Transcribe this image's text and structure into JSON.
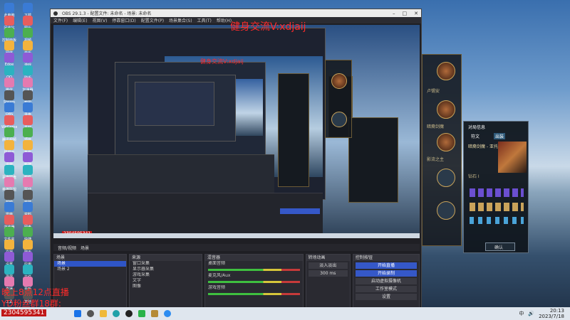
{
  "desktop": {
    "icons_col1": [
      "此电脑",
      "回收站",
      "控制面板",
      "网络",
      "Edge",
      "QQ",
      "微信",
      "Steam",
      "OBS",
      "WeGame",
      "腾讯视频",
      "网易云",
      "迅雷",
      "百度网盘",
      "英雄联盟",
      "剪映",
      "雷电",
      "浏览器",
      "文件夹",
      "文档",
      "设置",
      "录屏",
      "直播",
      "工具"
    ],
    "icons_col2": [
      "下载",
      "图片",
      "视频",
      "音乐",
      "游戏",
      "助手",
      "加速器",
      "截图",
      "录像",
      "素材",
      "项目",
      "备份",
      "新建",
      "软件",
      "驱动",
      "安装",
      "资料",
      "网盘",
      "快捷",
      "聊天",
      "应用",
      "文件",
      "更新",
      "其他"
    ]
  },
  "obs": {
    "title": "OBS 29.1.3 - 配置文件: 未命名 - 场景: 未命名",
    "menu": [
      "文件(F)",
      "编辑(E)",
      "视图(V)",
      "停靠窗口(D)",
      "配置文件(P)",
      "场景集合(S)",
      "工具(T)",
      "帮助(H)"
    ],
    "dock_tabs": [
      "音频/视频",
      "场景"
    ],
    "scenes": {
      "header": "场景",
      "items": [
        "场景",
        "场景 2"
      ]
    },
    "sources": {
      "header": "来源",
      "items": [
        "窗口采集",
        "显示器采集",
        "游戏采集",
        "文字",
        "图像"
      ]
    },
    "mixer": {
      "header": "混音器",
      "channels": [
        "桌面音频",
        "麦克风/Aux",
        "游戏音频"
      ],
      "levels": [
        0.62,
        0.48,
        0.35
      ]
    },
    "transitions": {
      "header": "转场动画",
      "type": "淡入淡出",
      "duration": "300 ms"
    },
    "controls": {
      "header": "控制按钮",
      "buttons": [
        "开始直播",
        "开始录制",
        "启动虚拟摄像机",
        "工作室模式",
        "设置",
        "退出"
      ]
    },
    "status": "CPU: 3.1%, 60.00 / 60.00 FPS"
  },
  "overlay": {
    "title_red": "健身交流V:xdjaij",
    "nested_red": "健身交流V:xdjaij",
    "bottom_left": [
      "晚上8点12点直播",
      "YD粉丝群18群:"
    ],
    "id_box": "2304595341",
    "small_id": "2304595341"
  },
  "game": {
    "names": [
      "卢锡安",
      "暗裔剑魔",
      "寒冰射手",
      "蒸汽机器人",
      "影流之主"
    ],
    "panel_title": "对局信息",
    "tabs": [
      "符文",
      "出装"
    ],
    "champ": "暗裔剑魔 - 亚托克斯",
    "rank": "钻石 I",
    "confirm": "确认"
  },
  "taskbar": {
    "time": "20:13",
    "date": "2023/7/18",
    "lang": "中"
  }
}
